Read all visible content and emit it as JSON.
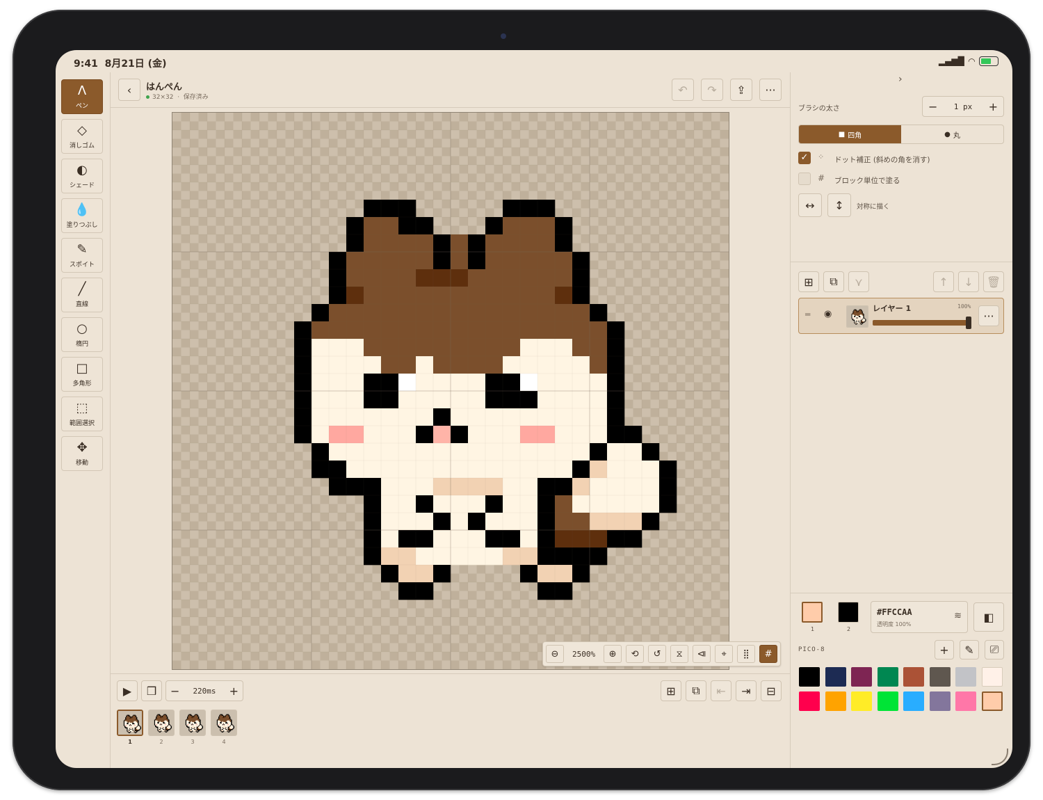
{
  "status": {
    "time": "9:41",
    "date": "8月21日 (金)"
  },
  "doc": {
    "title": "はんぺん",
    "size": "32×32",
    "state": "保存済み",
    "separator": "·"
  },
  "tools": [
    {
      "label": "ペン",
      "icon": "pen-icon",
      "glyph": "Ʌ"
    },
    {
      "label": "消しゴム",
      "icon": "eraser-icon",
      "glyph": "◇"
    },
    {
      "label": "シェード",
      "icon": "shade-icon",
      "glyph": "◐"
    },
    {
      "label": "塗りつぶし",
      "icon": "fill-drop-icon",
      "glyph": "💧"
    },
    {
      "label": "スポイト",
      "icon": "eyedropper-icon",
      "glyph": "✎"
    },
    {
      "label": "直線",
      "icon": "line-icon",
      "glyph": "╱"
    },
    {
      "label": "楕円",
      "icon": "ellipse-icon",
      "glyph": "○"
    },
    {
      "label": "多角形",
      "icon": "polygon-icon",
      "glyph": "□"
    },
    {
      "label": "範囲選択",
      "icon": "selection-icon",
      "glyph": "⬚"
    },
    {
      "label": "移動",
      "icon": "move-icon",
      "glyph": "✥"
    }
  ],
  "zoom": {
    "value": "2500%"
  },
  "animation": {
    "interval": "220ms",
    "frames": [
      "1",
      "2",
      "3",
      "4"
    ]
  },
  "brush": {
    "size_label": "ブラシの太さ",
    "size_value": "1 px",
    "shape_square": "四角",
    "shape_round": "丸",
    "opt_dot_fix": "ドット補正 (斜めの角を消す)",
    "opt_block": "ブロック単位で塗る",
    "symmetry": "対称に描く"
  },
  "layer": {
    "name": "レイヤー 1",
    "opacity": "100%",
    "opacity_value": 1.0
  },
  "color": {
    "primary_hex": "#FFCCAA",
    "secondary_hex": "#000000",
    "hex_label": "#FFCCAA",
    "opacity_label": "透明度 100%",
    "slot1": "1",
    "slot2": "2",
    "palette_name": "PICO-8",
    "palette": [
      "#000000",
      "#1D2B53",
      "#7E2553",
      "#008751",
      "#AB5236",
      "#5F574F",
      "#C2C3C7",
      "#FFF1E8",
      "#FF004D",
      "#FFA300",
      "#FFEC27",
      "#00E436",
      "#29ADFF",
      "#83769C",
      "#FF77A8",
      "#FFCCAA"
    ]
  },
  "colors": {
    "accent": "#8B5A2B",
    "background": "#EDE3D5"
  }
}
